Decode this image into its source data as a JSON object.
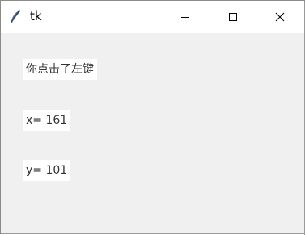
{
  "window": {
    "title": "tk",
    "icon": "feather-icon"
  },
  "titlebar_buttons": {
    "minimize": "minimize-icon",
    "maximize": "maximize-icon",
    "close": "close-icon"
  },
  "labels": {
    "message": "你点击了左键",
    "x": "x= 161",
    "y": "y= 101"
  }
}
